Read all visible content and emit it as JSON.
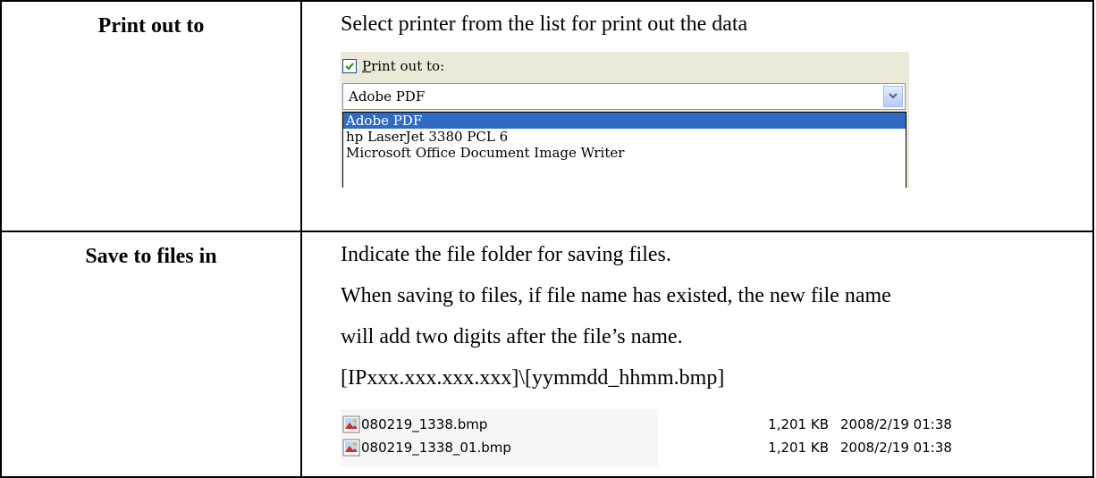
{
  "rows": [
    {
      "label": "Print out to",
      "description": "Select printer from the list for print out the data",
      "widget": {
        "checkbox_label": "Print out to:",
        "checkbox_checked": true,
        "selected_printer": "Adobe PDF",
        "options": [
          "Adobe PDF",
          "hp LaserJet 3380 PCL 6",
          "Microsoft Office Document Image Writer"
        ]
      }
    },
    {
      "label": "Save to files in",
      "lines": [
        "Indicate the file folder for saving files.",
        "When saving to files, if file name has existed, the new file name",
        "will add two digits after the file’s name.",
        "[IPxxx.xxx.xxx.xxx]\\[yymmdd_hhmm.bmp]"
      ],
      "files": [
        {
          "name": "080219_1338.bmp",
          "size": "1,201 KB",
          "date": "2008/2/19 01:38"
        },
        {
          "name": "080219_1338_01.bmp",
          "size": "1,201 KB",
          "date": "2008/2/19 01:38"
        }
      ]
    }
  ],
  "colors": {
    "selection": "#316ac5",
    "checkmark": "#21a121",
    "panel": "#ece9d8"
  },
  "icons": {
    "checkbox": "checkmark-icon",
    "dropdown": "chevron-down-icon",
    "file": "bitmap-file-icon"
  }
}
